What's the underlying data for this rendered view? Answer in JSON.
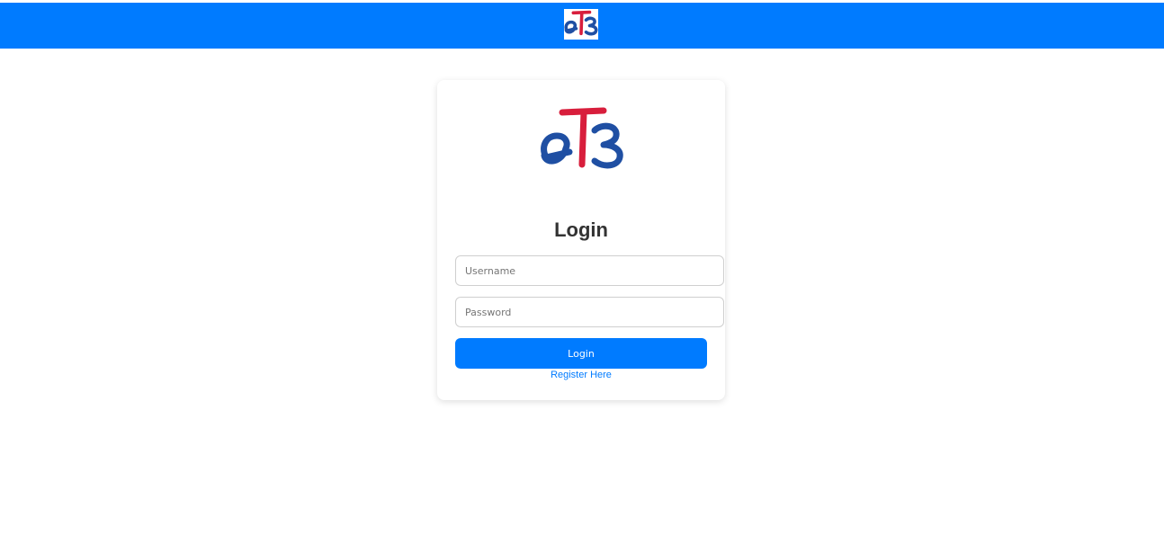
{
  "header": {
    "logo_icon": "et3-logo-icon",
    "background_color": "#007bff"
  },
  "login_card": {
    "logo_icon": "et3-logo-icon",
    "title": "Login",
    "username": {
      "placeholder": "Username",
      "value": ""
    },
    "password": {
      "placeholder": "Password",
      "value": ""
    },
    "login_button_label": "Login",
    "register_link_text": "Register Here"
  },
  "colors": {
    "primary": "#007bff",
    "logo_blue": "#1f4fa3",
    "logo_red": "#d81e3c",
    "title_text": "#333333"
  }
}
